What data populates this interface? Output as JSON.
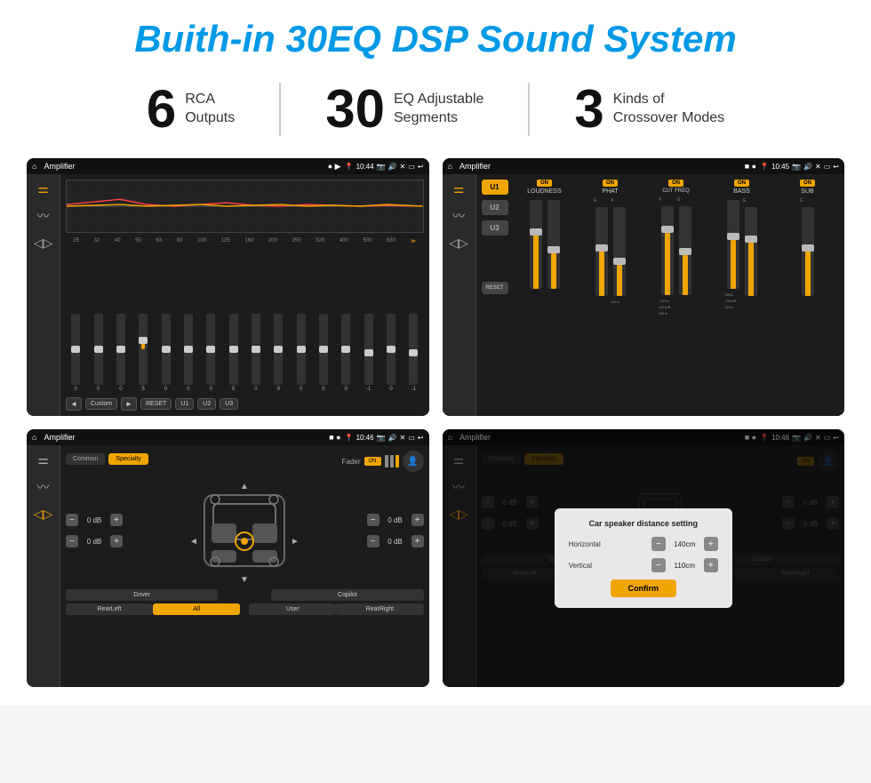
{
  "header": {
    "title": "Buith-in 30EQ DSP Sound System"
  },
  "stats": [
    {
      "number": "6",
      "line1": "RCA",
      "line2": "Outputs"
    },
    {
      "number": "30",
      "line1": "EQ Adjustable",
      "line2": "Segments"
    },
    {
      "number": "3",
      "line1": "Kinds of",
      "line2": "Crossover Modes"
    }
  ],
  "screens": {
    "eq": {
      "title": "Amplifier",
      "time": "10:44",
      "freqs": [
        "25",
        "32",
        "40",
        "50",
        "63",
        "80",
        "100",
        "125",
        "160",
        "200",
        "250",
        "320",
        "400",
        "500",
        "630"
      ],
      "values": [
        "0",
        "0",
        "0",
        "5",
        "0",
        "0",
        "0",
        "0",
        "0",
        "0",
        "0",
        "0",
        "0",
        "-1",
        "0",
        "-1"
      ],
      "buttons": [
        "Custom",
        "RESET",
        "U1",
        "U2",
        "U3"
      ]
    },
    "crossover": {
      "title": "Amplifier",
      "time": "10:45",
      "units": [
        "U1",
        "U2",
        "U3"
      ],
      "channels": [
        "LOUDNESS",
        "PHAT",
        "CUT FREQ",
        "BASS",
        "SUB"
      ]
    },
    "fader": {
      "title": "Amplifier",
      "time": "10:46",
      "tabs": [
        "Common",
        "Specialty"
      ],
      "fader_label": "Fader",
      "on_label": "ON",
      "db_values": [
        "0 dB",
        "0 dB",
        "0 dB",
        "0 dB"
      ],
      "bottom_buttons": [
        "Driver",
        "",
        "Copilot",
        "RearLeft",
        "All",
        "",
        "User",
        "RearRight"
      ]
    },
    "distance": {
      "title": "Amplifier",
      "time": "10:46",
      "dialog_title": "Car speaker distance setting",
      "horizontal_label": "Horizontal",
      "horizontal_value": "140cm",
      "vertical_label": "Vertical",
      "vertical_value": "110cm",
      "confirm_label": "Confirm",
      "tabs": [
        "Common",
        "Specialty"
      ]
    }
  }
}
